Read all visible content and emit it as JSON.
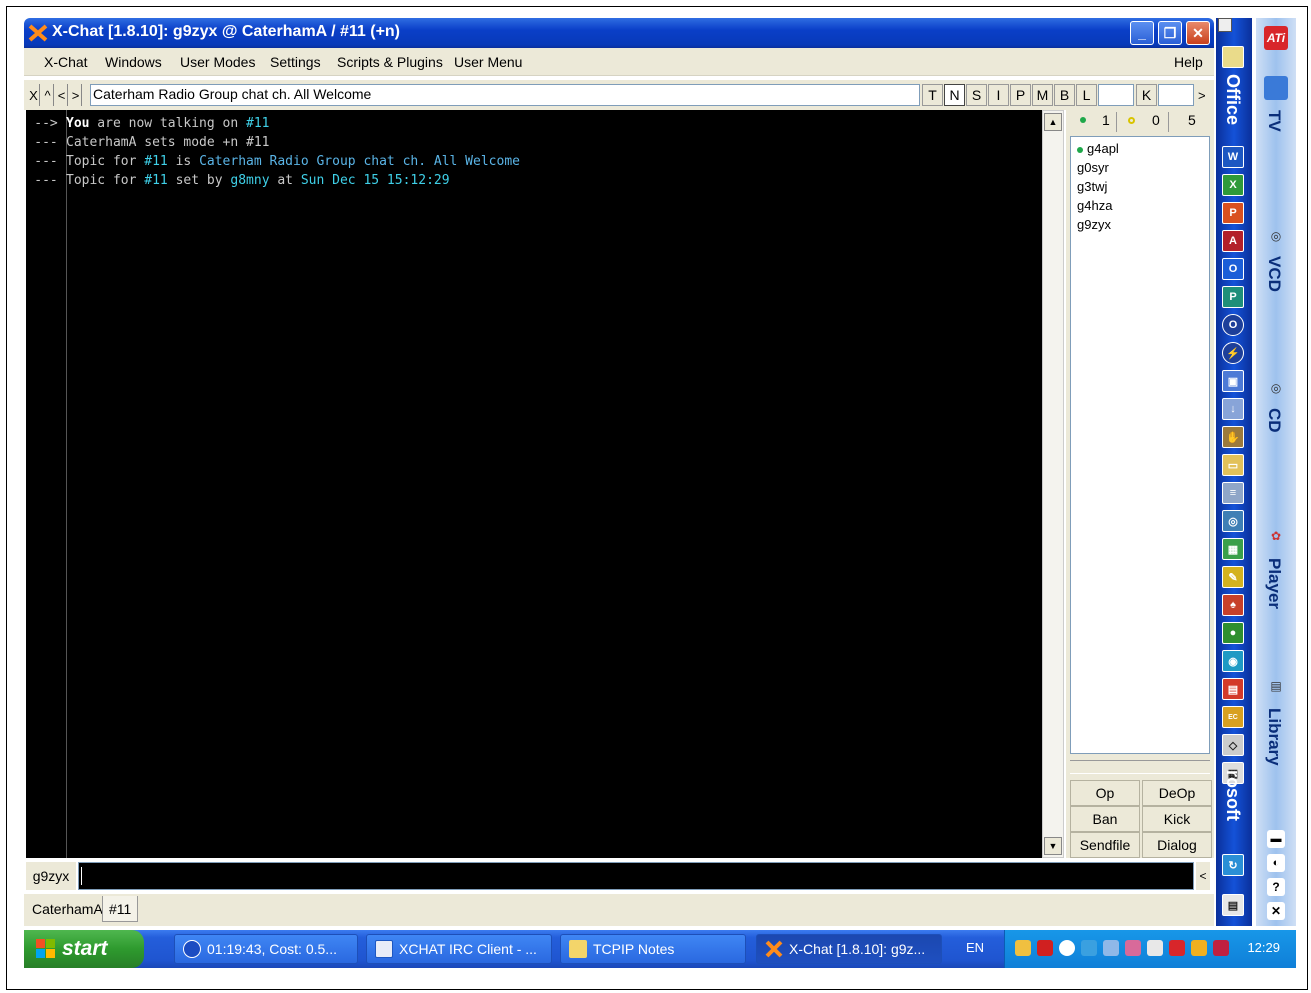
{
  "window": {
    "title": "X-Chat [1.8.10]: g9zyx @ CaterhamA / #11 (+n)",
    "controls": {
      "minimize": "_",
      "maximize": "❐",
      "close": "✕"
    }
  },
  "menu": {
    "items": [
      "X-Chat",
      "Windows",
      "User Modes",
      "Settings",
      "Scripts & Plugins",
      "User Menu"
    ],
    "help": "Help"
  },
  "topicbar": {
    "buttons": [
      "X",
      "^",
      "<",
      ">"
    ],
    "topic": "Caterham Radio Group chat ch. All Welcome",
    "modes": [
      "T",
      "N",
      "S",
      "I",
      "P",
      "M",
      "B",
      "L"
    ],
    "key_label": "K",
    "arrow": ">"
  },
  "chat": {
    "lines": [
      {
        "prefix": "-->",
        "parts": [
          {
            "t": "You",
            "c": "white"
          },
          {
            "t": " are now talking on ",
            "c": "grey"
          },
          {
            "t": "#11",
            "c": "cyan"
          }
        ]
      },
      {
        "prefix": "---",
        "parts": [
          {
            "t": "CaterhamA sets mode +n #11",
            "c": "grey"
          }
        ]
      },
      {
        "prefix": "---",
        "parts": [
          {
            "t": "Topic for ",
            "c": "grey"
          },
          {
            "t": "#11",
            "c": "cyan"
          },
          {
            "t": " is ",
            "c": "grey"
          },
          {
            "t": "Caterham Radio Group chat ch. All Welcome",
            "c": "blue"
          }
        ]
      },
      {
        "prefix": "---",
        "parts": [
          {
            "t": "Topic for ",
            "c": "grey"
          },
          {
            "t": "#11",
            "c": "cyan"
          },
          {
            "t": " set by ",
            "c": "grey"
          },
          {
            "t": "g8mny",
            "c": "cyan"
          },
          {
            "t": " at ",
            "c": "grey"
          },
          {
            "t": "Sun Dec 15 15:12:29",
            "c": "cyan"
          }
        ]
      }
    ]
  },
  "userlist": {
    "ops_count": "1",
    "voice_count": "0",
    "total": "5",
    "users": [
      {
        "nick": "g4apl",
        "op": true
      },
      {
        "nick": "g0syr",
        "op": false
      },
      {
        "nick": "g3twj",
        "op": false
      },
      {
        "nick": "g4hza",
        "op": false
      },
      {
        "nick": "g9zyx",
        "op": false
      }
    ],
    "buttons": [
      "Op",
      "DeOp",
      "Ban",
      "Kick",
      "Sendfile",
      "Dialog"
    ]
  },
  "input": {
    "nick": "g9zyx",
    "value": "",
    "arrow": "<"
  },
  "tabs": [
    "CaterhamA",
    "#11"
  ],
  "officebar": {
    "top_label": "Office",
    "bottom_label": "rosoft"
  },
  "mediabar": {
    "labels": [
      "TV",
      "VCD",
      "CD",
      "Player",
      "Library"
    ]
  },
  "taskbar": {
    "start": "start",
    "tasks": [
      {
        "label": "01:19:43, Cost: 0.5...",
        "icon": "dialup-icon"
      },
      {
        "label": "XCHAT IRC Client - ...",
        "icon": "word-icon"
      },
      {
        "label": "TCPIP Notes",
        "icon": "folder-icon"
      },
      {
        "label": "X-Chat [1.8.10]: g9z...",
        "icon": "xchat-icon",
        "active": true
      }
    ],
    "language": "EN",
    "clock": "12:29"
  },
  "colors": {
    "titlebar": "#0a3fc8",
    "chat_bg": "#000000",
    "cyan": "#3fd0e8",
    "taskbar": "#245edb",
    "start": "#2e9a2e"
  }
}
